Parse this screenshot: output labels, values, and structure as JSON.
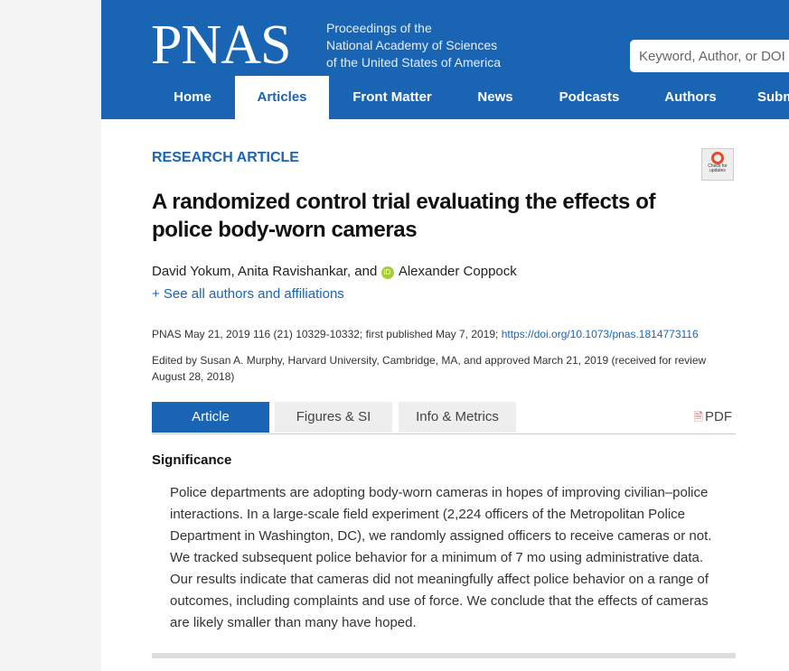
{
  "header": {
    "logo": "PNAS",
    "subtitle_lines": [
      "Proceedings of the",
      "National Academy of Sciences",
      "of the United States of America"
    ],
    "search_placeholder": "Keyword, Author, or DOI",
    "nav": [
      "Home",
      "Articles",
      "Front Matter",
      "News",
      "Podcasts",
      "Authors",
      "Subm"
    ],
    "active_nav": "Articles"
  },
  "badge": {
    "text_line1": "Check for",
    "text_line2": "updates"
  },
  "article": {
    "kicker": "RESEARCH ARTICLE",
    "title_line1": "A randomized control trial evaluating the effects of",
    "title_line2": "police body-worn cameras",
    "authors_part1": "David Yokum, Anita Ravishankar, and ",
    "authors_part2": "Alexander Coppock",
    "orcid_label": "iD",
    "see_all": "+ See all authors and affiliations",
    "citation": "PNAS May 21, 2019 116 (21) 10329-10332; first published May 7, 2019; ",
    "doi": "https://doi.org/10.1073/pnas.1814773116",
    "edited": "Edited by Susan A. Murphy, Harvard University, Cambridge, MA, and approved March 21, 2019 (received for review August 28, 2018)"
  },
  "tabs": {
    "items": [
      "Article",
      "Figures & SI",
      "Info & Metrics"
    ],
    "active": "Article",
    "pdf": "PDF"
  },
  "significance": {
    "heading": "Significance",
    "body": "Police departments are adopting body-worn cameras in hopes of improving civilian–police interactions. In a large-scale field experiment (2,224 officers of the Metropolitan Police Department in Washington, DC), we randomly assigned officers to receive cameras or not. We tracked subsequent police behavior for a minimum of 7 mo using administrative data. Our results indicate that cameras did not meaningfully affect police behavior on a range of outcomes, including complaints and use of force. We conclude that the effects of cameras are likely smaller than many have hoped."
  },
  "colors": {
    "brand_blue": "#1a64b4",
    "orcid_green": "#a6ce39",
    "pdf_red": "#d9534f"
  }
}
